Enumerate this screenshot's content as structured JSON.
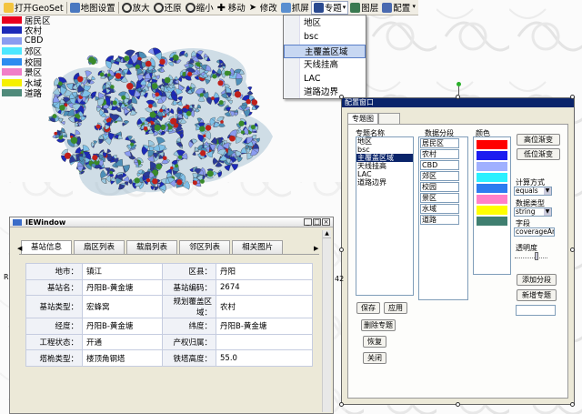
{
  "toolbar": {
    "items": [
      {
        "label": "打开GeoSet",
        "icon": "open-folder-icon"
      },
      {
        "label": "地图设置",
        "icon": "map-settings-icon"
      },
      {
        "label": "放大",
        "icon": "zoom-in-icon"
      },
      {
        "label": "还原",
        "icon": "restore-icon"
      },
      {
        "label": "缩小",
        "icon": "zoom-out-icon"
      },
      {
        "label": "移动",
        "icon": "pan-icon"
      },
      {
        "label": "修改",
        "icon": "edit-pointer-icon"
      },
      {
        "label": "抓屏",
        "icon": "screenshot-icon"
      },
      {
        "label": "专题",
        "icon": "thematic-icon"
      },
      {
        "label": "图层",
        "icon": "layers-icon"
      },
      {
        "label": "配置",
        "icon": "config-icon"
      }
    ]
  },
  "thematic_menu": {
    "items": [
      "地区",
      "bsc",
      "主覆盖区域",
      "天线挂高",
      "LAC",
      "道路边界"
    ],
    "selected_index": 2
  },
  "legend": [
    {
      "label": "居民区",
      "color": "#e8001e"
    },
    {
      "label": "农村",
      "color": "#1c2ab8"
    },
    {
      "label": "CBD",
      "color": "#8a9cf0"
    },
    {
      "label": "郊区",
      "color": "#4de7ff"
    },
    {
      "label": "校园",
      "color": "#2c8cf0"
    },
    {
      "label": "景区",
      "color": "#f07ec8"
    },
    {
      "label": "水域",
      "color": "#f6f000"
    },
    {
      "label": "道路",
      "color": "#4f8a7a"
    }
  ],
  "config_window": {
    "title": "配置窗口",
    "tabs": [
      "专题图",
      ""
    ],
    "col_name": "专题名称",
    "col_segments": "数据分段",
    "col_colors": "颜色",
    "topic_names": [
      "地区",
      "bsc",
      "主覆盖区域",
      "天线挂高",
      "LAC",
      "道路边界"
    ],
    "topic_selected_index": 2,
    "segments": [
      "居民区",
      "农村",
      "CBD",
      "郊区",
      "校园",
      "景区",
      "水域",
      "道路"
    ],
    "colors": [
      "#ff0000",
      "#1c1cf0",
      "#a0b0ff",
      "#2cf0ff",
      "#2c7cf0",
      "#ff80c8",
      "#ffff00",
      "#3f7f70"
    ],
    "btn_high_gradient": "高位渐变",
    "btn_low_gradient": "低位渐变",
    "calc_label": "计算方式",
    "calc_value": "equals",
    "datatype_label": "数据类型",
    "datatype_value": "string",
    "field_label": "字段",
    "field_value": "coverageArea",
    "opacity_label": "透明度",
    "btn_add_segment": "添加分段",
    "btn_new_topic": "新增专题",
    "btn_save": "保存",
    "btn_apply": "应用",
    "btn_delete": "删除专题",
    "btn_restore": "恢复",
    "btn_close": "关闭"
  },
  "ie_window": {
    "title": "IEWindow",
    "tabs": [
      "基站信息",
      "扇区列表",
      "载扇列表",
      "邻区列表",
      "相关图片"
    ],
    "rows": [
      [
        "地市：",
        "镇江",
        "区县：",
        "丹阳"
      ],
      [
        "基站名：",
        "丹阳B-黄金塘",
        "基站编码：",
        "2674"
      ],
      [
        "基站类型：",
        "宏蜂窝",
        "规划覆盖区域：",
        "农村"
      ],
      [
        "经度：",
        "丹阳B-黄金塘",
        "纬度：",
        "丹阳B-黄金塘"
      ],
      [
        "工程状态：",
        "开通",
        "产权归属：",
        ""
      ],
      [
        "塔桅类型：",
        "楼顶角钢塔",
        "铁塔高度：",
        "55.0"
      ]
    ]
  },
  "background_fragment": "R",
  "background_number": "42"
}
